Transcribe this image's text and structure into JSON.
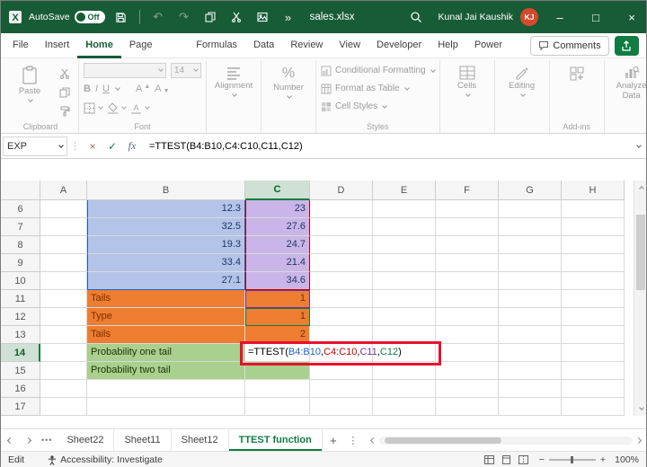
{
  "colors": {
    "title_green": "#185c37",
    "accent_green": "#107c41",
    "blue_fill": "#b3c4e8",
    "blue_text": "#1f3864",
    "purple_fill": "#c9b5e8",
    "orange_fill": "#ed7d31",
    "orange_text": "#7c2d00",
    "green_fill": "#a9d08e",
    "green_text": "#213307",
    "ref_blue": "#1f61c9",
    "ref_red": "#c00000",
    "ref_purple": "#7030a0",
    "ref_green": "#107c41",
    "annotation_red": "#e8112d"
  },
  "titlebar": {
    "autosave_label": "AutoSave",
    "autosave_state": "Off",
    "filename": "sales.xlsx",
    "user_name": "Kunal Jai Kaushik",
    "user_initials": "KJ"
  },
  "menubar": {
    "tabs": [
      "File",
      "Insert",
      "Home",
      "Page Layout",
      "Formulas",
      "Data",
      "Review",
      "View",
      "Developer",
      "Help",
      "Power Pivot"
    ],
    "active": "Home",
    "comments_label": "Comments"
  },
  "ribbon": {
    "paste_label": "Paste",
    "clipboard_label": "Clipboard",
    "bold": "B",
    "italic": "I",
    "underline": "U",
    "font_size": "14",
    "font_label": "Font",
    "alignment_label": "Alignment",
    "number_label": "Number",
    "percent": "%",
    "styles_items": [
      "Conditional Formatting",
      "Format as Table",
      "Cell Styles"
    ],
    "styles_label": "Styles",
    "cells_label": "Cells",
    "editing_label": "Editing",
    "addins_label": "Add-ins",
    "analyze_label": "Analyze Data"
  },
  "formula_bar": {
    "name_box": "EXP",
    "fx": "fx",
    "formula": "=TTEST(B4:B10,C4:C10,C11,C12)"
  },
  "sheet": {
    "columns": [
      "A",
      "B",
      "C",
      "D",
      "E",
      "F",
      "G",
      "H"
    ],
    "active_column": "C",
    "active_row": 14,
    "rows": [
      {
        "n": 6,
        "b": "12.3",
        "c": "23",
        "style": "blue"
      },
      {
        "n": 7,
        "b": "32.5",
        "c": "27.6",
        "style": "blue"
      },
      {
        "n": 8,
        "b": "19.3",
        "c": "24.7",
        "style": "blue"
      },
      {
        "n": 9,
        "b": "33.4",
        "c": "21.4",
        "style": "blue"
      },
      {
        "n": 10,
        "b": "27.1",
        "c": "34.6",
        "style": "blue"
      },
      {
        "n": 11,
        "b": "Tails",
        "c": "1",
        "style": "orange",
        "c_ref": "purple"
      },
      {
        "n": 12,
        "b": "Type",
        "c": "1",
        "style": "orange",
        "c_ref": "green"
      },
      {
        "n": 13,
        "b": "Tails",
        "c": "2",
        "style": "orange"
      },
      {
        "n": 14,
        "b": "Probability one tail",
        "c": "",
        "style": "green",
        "formula": true
      },
      {
        "n": 15,
        "b": "Probability two tail",
        "c": "",
        "style": "green"
      },
      {
        "n": 16,
        "b": "",
        "c": "",
        "style": "plain"
      },
      {
        "n": 17,
        "b": "",
        "c": "",
        "style": "plain"
      }
    ],
    "formula_segments": [
      {
        "text": "=TTEST(",
        "color": "#000000"
      },
      {
        "text": "B4:B10",
        "color": "#1f61c9"
      },
      {
        "text": ",",
        "color": "#000000"
      },
      {
        "text": "C4:C10",
        "color": "#c00000"
      },
      {
        "text": ",",
        "color": "#000000"
      },
      {
        "text": "C11",
        "color": "#7030a0"
      },
      {
        "text": ",",
        "color": "#000000"
      },
      {
        "text": "C12",
        "color": "#107c41"
      },
      {
        "text": ")",
        "color": "#000000"
      }
    ]
  },
  "sheet_tabs": {
    "tabs": [
      "Sheet22",
      "Sheet11",
      "Sheet12",
      "TTEST function"
    ],
    "active": "TTEST function"
  },
  "status_bar": {
    "mode": "Edit",
    "accessibility": "Accessibility: Investigate",
    "zoom": "100%"
  },
  "glyphs": {
    "undo": "↶",
    "redo": "↷",
    "more": "»",
    "check": "✓",
    "close_x": "×",
    "minimize": "–",
    "maximize": "□",
    "ellipsis": "•••",
    "plus": "+",
    "zoom_out": "−",
    "zoom_in": "+"
  }
}
